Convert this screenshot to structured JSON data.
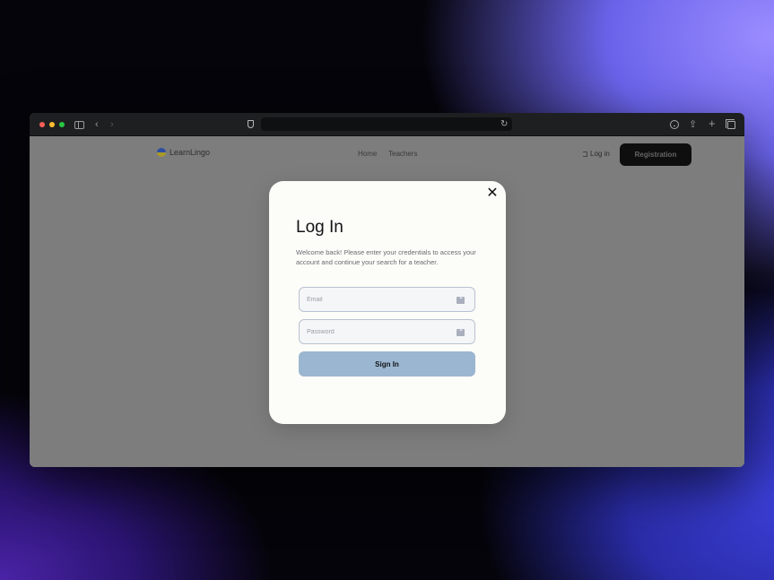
{
  "browser": {
    "icons": [
      "sidebar-icon",
      "chevron-left-icon",
      "chevron-right-icon",
      "shield-icon",
      "reload-icon",
      "download-icon",
      "share-icon",
      "plus-icon",
      "tabs-icon"
    ],
    "back_glyph": "‹",
    "forward_glyph": "›",
    "reload_glyph": "↻",
    "share_glyph": "⇪",
    "plus_glyph": "+"
  },
  "site": {
    "logo_text": "LearnLingo",
    "nav": [
      "Home",
      "Teachers"
    ],
    "login_label": "Log in",
    "register_label": "Registration"
  },
  "modal": {
    "close_glyph": "✕",
    "title": "Log In",
    "description": "Welcome back! Please enter your credentials to access your account and continue your search for a teacher.",
    "email_placeholder": "Email",
    "password_placeholder": "Password",
    "submit_label": "Sign In"
  },
  "colors": {
    "accent_button": "#9bb6d0",
    "modal_bg": "#fcfcf8",
    "overlay": "#7d7d7d"
  }
}
